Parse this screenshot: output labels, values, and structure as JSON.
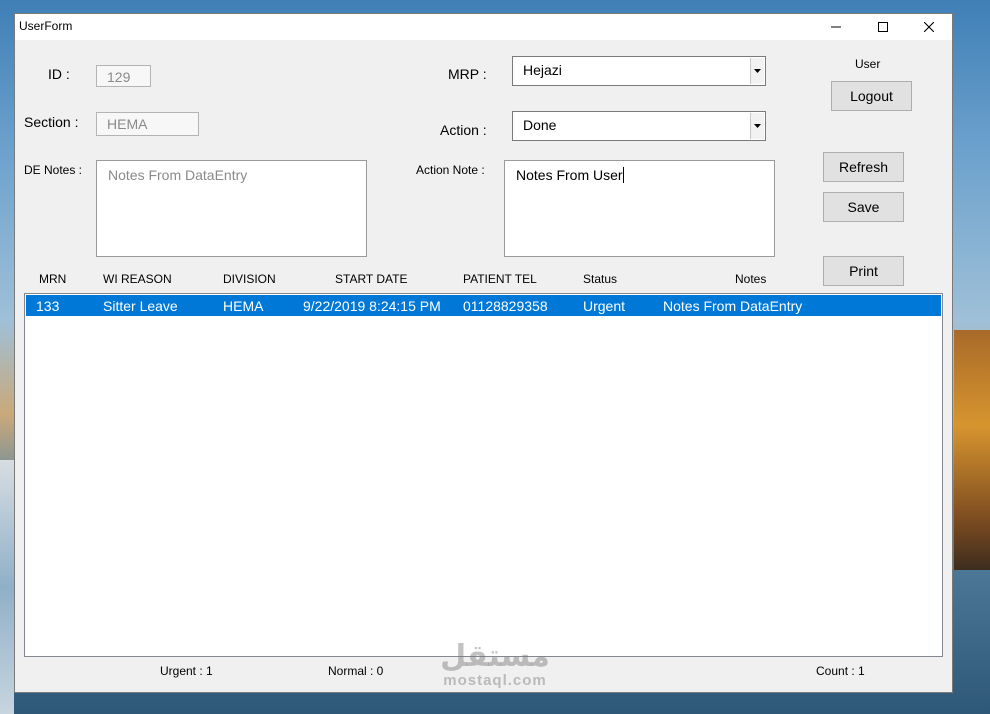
{
  "window": {
    "title": "UserForm"
  },
  "fields": {
    "id_label": "ID :",
    "id_value": "129",
    "section_label": "Section :",
    "section_value": "HEMA",
    "de_notes_label": "DE Notes :",
    "de_notes_value": "Notes From DataEntry",
    "mrp_label": "MRP :",
    "mrp_value": "Hejazi",
    "action_label": "Action :",
    "action_value": "Done",
    "action_note_label": "Action Note :",
    "action_note_value": "Notes From User"
  },
  "user_panel": {
    "label": "User",
    "logout": "Logout"
  },
  "buttons": {
    "refresh": "Refresh",
    "save": "Save",
    "print": "Print"
  },
  "list": {
    "columns": [
      "MRN",
      "WI REASON",
      "DIVISION",
      "START DATE",
      "PATIENT TEL",
      "Status",
      "Notes"
    ],
    "rows": [
      {
        "mrn": "133",
        "reason": "Sitter Leave",
        "division": "HEMA",
        "start_date": "9/22/2019 8:24:15 PM",
        "tel": "01128829358",
        "status": "Urgent",
        "notes": "Notes From DataEntry"
      }
    ]
  },
  "statusbar": {
    "urgent": "Urgent : 1",
    "normal": "Normal : 0",
    "count": "Count : 1"
  },
  "watermark": {
    "arabic": "مستقل",
    "latin": "mostaql.com"
  },
  "colors": {
    "selection": "#0078d7",
    "window_bg": "#f0f0f0"
  }
}
